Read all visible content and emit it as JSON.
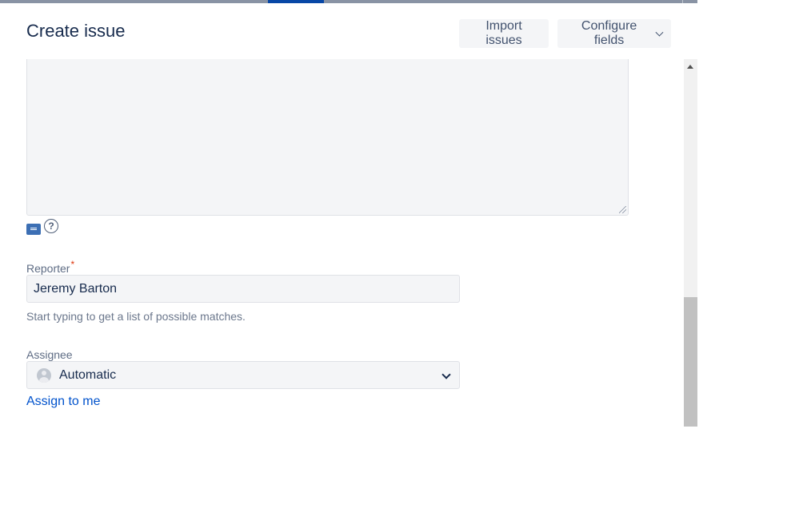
{
  "dialog": {
    "title": "Create issue",
    "import_label": "Import issues",
    "configure_label": "Configure fields"
  },
  "editor": {
    "help_glyph": "?"
  },
  "reporter": {
    "label": "Reporter",
    "required_mark": "*",
    "value": "Jeremy Barton",
    "hint": "Start typing to get a list of possible matches."
  },
  "assignee": {
    "label": "Assignee",
    "selected": "Automatic",
    "assign_to_me": "Assign to me"
  },
  "colors": {
    "accent": "#0052cc",
    "required": "#de350b",
    "field_bg": "#f4f5f7"
  },
  "icons": [
    "editor-mode-icon",
    "help-icon",
    "chevron-down-icon",
    "avatar-icon",
    "scroll-up-arrow-icon"
  ]
}
